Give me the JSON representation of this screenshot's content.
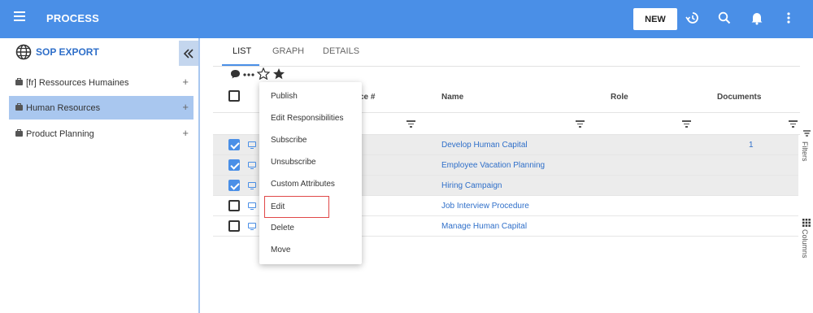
{
  "header": {
    "title": "PROCESS",
    "new_label": "NEW",
    "icons": [
      "menu-icon",
      "history-icon",
      "search-icon",
      "bell-icon",
      "more-vert-icon"
    ]
  },
  "sidebar": {
    "title": "SOP EXPORT",
    "collapse_icon": "chevrons-left-icon",
    "items": [
      {
        "label": "[fr] Ressources Humaines",
        "active": false
      },
      {
        "label": "Human Resources",
        "active": true
      },
      {
        "label": "Product Planning",
        "active": false
      }
    ]
  },
  "tabs": [
    "LIST",
    "GRAPH",
    "DETAILS"
  ],
  "table": {
    "columns": [
      "ce #",
      "Name",
      "Role",
      "Documents"
    ],
    "rows": [
      {
        "checked": true,
        "name": "Develop Human Capital",
        "documents": "1"
      },
      {
        "checked": true,
        "name": "Employee Vacation Planning",
        "documents": ""
      },
      {
        "checked": true,
        "name": "Hiring Campaign",
        "documents": ""
      },
      {
        "checked": false,
        "name": "Job Interview Procedure",
        "documents": ""
      },
      {
        "checked": false,
        "name": "Manage Human Capital",
        "documents": ""
      }
    ]
  },
  "context_menu": {
    "items": [
      "Publish",
      "Edit Responsibilities",
      "Subscribe",
      "Unsubscribe",
      "Custom Attributes",
      "Edit",
      "Delete",
      "Move"
    ],
    "highlighted": "Edit"
  },
  "side_rail": {
    "filters_label": "Filters",
    "columns_label": "Columns"
  },
  "colors": {
    "brand": "#4a8fe7",
    "link": "#2f6fc9",
    "selected_item": "#a9c7ef",
    "highlight_border": "#e04848"
  }
}
